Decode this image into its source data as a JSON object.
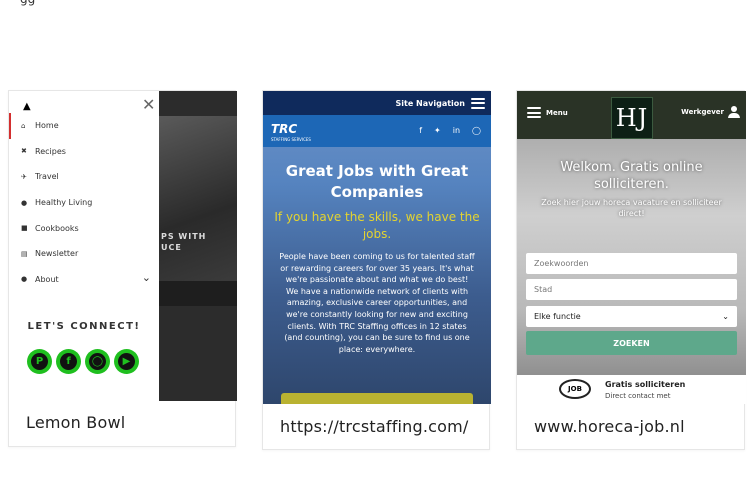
{
  "top_fragment": "gg",
  "cards": [
    {
      "caption": "Lemon Bowl",
      "menu": {
        "close": "✕",
        "items": [
          {
            "label": "Home",
            "icon": "home-icon"
          },
          {
            "label": "Recipes",
            "icon": "utensils-icon"
          },
          {
            "label": "Travel",
            "icon": "plane-icon"
          },
          {
            "label": "Healthy Living",
            "icon": "person-icon"
          },
          {
            "label": "Cookbooks",
            "icon": "book-icon"
          },
          {
            "label": "Newsletter",
            "icon": "newspaper-icon"
          },
          {
            "label": "About",
            "icon": "user-icon"
          }
        ],
        "connect": "LET'S CONNECT!",
        "social": [
          "pinterest-icon",
          "facebook-icon",
          "instagram-icon",
          "youtube-icon"
        ],
        "background_text": "PS WITH\nUCE"
      }
    },
    {
      "caption": "https://trcstaffing.com/",
      "nav_label": "Site Navigation",
      "logo": "TRC",
      "logo_tagline": "STAFFING SERVICES",
      "social": [
        "facebook-icon",
        "twitter-icon",
        "linkedin-icon",
        "instagram-icon"
      ],
      "title": "Great Jobs with Great Companies",
      "subtitle": "If you have the skills, we have the jobs.",
      "body": "People have been coming to us for talented staff or rewarding careers for over 35 years. It's what we're passionate about and what we do best! We have a nationwide network of clients with amazing, exclusive career opportunities, and we're constantly looking for new and exciting clients. With TRC Staffing offices in 12 states (and counting), you can be sure to find us one place: everywhere."
    },
    {
      "caption": "www.horeca-job.nl",
      "menu_label": "Menu",
      "logo": "HJ",
      "employer_label": "Werkgever",
      "title": "Welkom. Gratis online solliciteren.",
      "subtitle": "Zoek hier jouw horeca vacature en solliciteer direct!",
      "keyword_placeholder": "Zoekwoorden",
      "city_placeholder": "Stad",
      "function_select": "Elke functie",
      "search_button": "ZOEKEN",
      "footer_logo": "JOB",
      "footer_title": "Gratis solliciteren",
      "footer_sub": "Direct contact met"
    }
  ]
}
